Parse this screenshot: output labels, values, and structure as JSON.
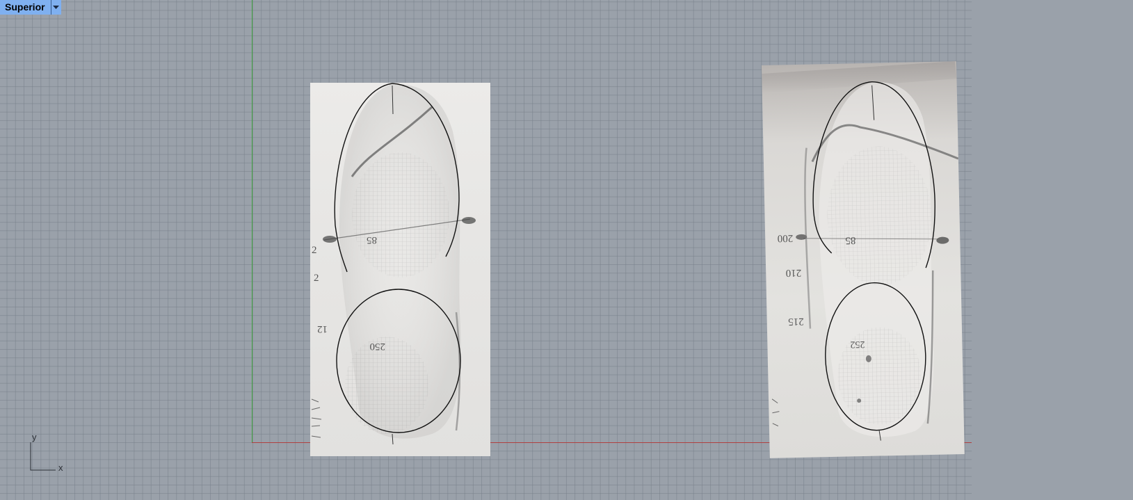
{
  "viewport": {
    "name": "Superior"
  },
  "axis_widget": {
    "y_label": "y",
    "x_label": "x"
  },
  "colors": {
    "background": "#9aa1aa",
    "grid": "#78808a",
    "x_axis": "#b04040",
    "y_axis": "#3fa33f",
    "tab": "#7fb0f0"
  },
  "photo_left": {
    "annotations": [
      "85",
      "250",
      "2",
      "2",
      "12"
    ]
  },
  "photo_right": {
    "annotations": [
      "200",
      "85",
      "210",
      "215",
      "252"
    ]
  }
}
